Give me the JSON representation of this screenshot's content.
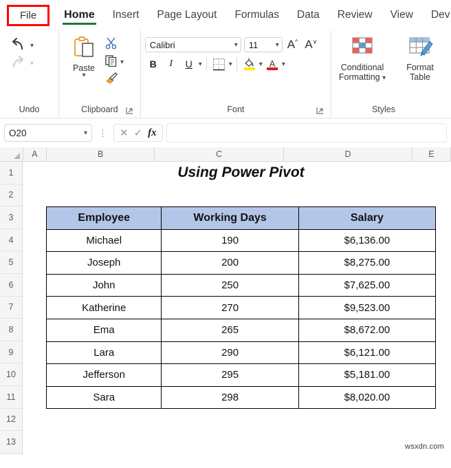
{
  "ribbon": {
    "tabs": [
      {
        "label": "File",
        "id": "file",
        "highlighted": true
      },
      {
        "label": "Home",
        "id": "home",
        "active": true
      },
      {
        "label": "Insert",
        "id": "insert"
      },
      {
        "label": "Page Layout",
        "id": "page-layout"
      },
      {
        "label": "Formulas",
        "id": "formulas"
      },
      {
        "label": "Data",
        "id": "data"
      },
      {
        "label": "Review",
        "id": "review"
      },
      {
        "label": "View",
        "id": "view"
      },
      {
        "label": "Dev",
        "id": "developer"
      }
    ],
    "groups": {
      "undo": {
        "label": "Undo",
        "undo_icon": "undo-arrow-icon",
        "redo_icon": "redo-arrow-icon"
      },
      "clipboard": {
        "label": "Clipboard",
        "paste_label": "Paste",
        "paste_icon": "clipboard-paste-icon",
        "cut_icon": "scissors-icon",
        "copy_icon": "copy-pages-icon",
        "format_painter_icon": "paintbrush-icon"
      },
      "font": {
        "label": "Font",
        "font_name": "Calibri",
        "font_size": "11",
        "grow_font_label": "A",
        "shrink_font_label": "A",
        "bold_label": "B",
        "italic_label": "I",
        "underline_label": "U",
        "borders_icon": "borders-grid-icon",
        "fill_color_icon": "fill-color-icon",
        "fill_color": "#ffe600",
        "font_color_icon": "font-color-icon",
        "font_color": "#e01b1b"
      },
      "styles": {
        "label": "Styles",
        "conditional_formatting_label": "Conditional\nFormatting",
        "conditional_formatting_line1": "Conditional",
        "conditional_formatting_line2": "Formatting",
        "format_table_line1": "Format",
        "format_table_line2": "Table",
        "conditional_formatting_icon": "conditional-formatting-icon",
        "format_as_table_icon": "format-as-table-icon"
      }
    },
    "accent_color": "#217346",
    "highlight_color": "#ff0000"
  },
  "formula_bar": {
    "name_box_value": "O20",
    "cancel_icon": "cancel-x-icon",
    "confirm_icon": "confirm-check-icon",
    "function_icon": "fx-icon",
    "formula_value": ""
  },
  "grid": {
    "column_headers": [
      "A",
      "B",
      "C",
      "D",
      "E"
    ],
    "row_headers": [
      "1",
      "2",
      "3",
      "4",
      "5",
      "6",
      "7",
      "8",
      "9",
      "10",
      "11",
      "12",
      "13"
    ],
    "sheet_title": "Using Power Pivot"
  },
  "table": {
    "headers": [
      "Employee",
      "Working Days",
      "Salary"
    ],
    "header_fill": "#b4c6e7",
    "rows": [
      {
        "employee": "Michael",
        "working_days": "190",
        "salary": "$6,136.00"
      },
      {
        "employee": "Joseph",
        "working_days": "200",
        "salary": "$8,275.00"
      },
      {
        "employee": "John",
        "working_days": "250",
        "salary": "$7,625.00"
      },
      {
        "employee": "Katherine",
        "working_days": "270",
        "salary": "$9,523.00"
      },
      {
        "employee": "Ema",
        "working_days": "265",
        "salary": "$8,672.00"
      },
      {
        "employee": "Lara",
        "working_days": "290",
        "salary": "$6,121.00"
      },
      {
        "employee": "Jefferson",
        "working_days": "295",
        "salary": "$5,181.00"
      },
      {
        "employee": "Sara",
        "working_days": "298",
        "salary": "$8,020.00"
      }
    ]
  },
  "watermark": {
    "text": "wsxdn.com"
  }
}
